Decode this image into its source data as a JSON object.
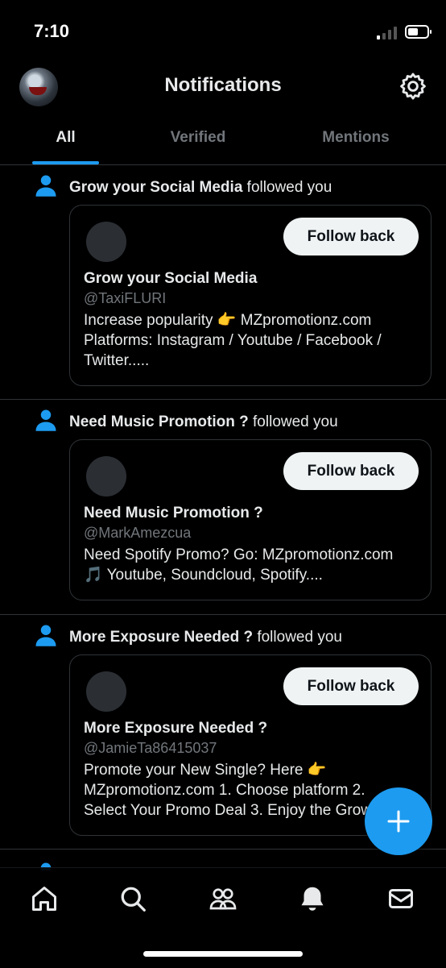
{
  "status": {
    "time": "7:10"
  },
  "header": {
    "title": "Notifications",
    "settings_icon": "gear-icon"
  },
  "tabs": [
    {
      "label": "All",
      "active": true
    },
    {
      "label": "Verified",
      "active": false
    },
    {
      "label": "Mentions",
      "active": false
    }
  ],
  "notifications": [
    {
      "actor": "Grow your Social Media",
      "action": " followed you",
      "card": {
        "follow_label": "Follow back",
        "name": "Grow your Social Media",
        "handle": "@TaxiFLURI",
        "bio": [
          "Increase popularity 👉 MZpromotionz.com",
          "Platforms: Instagram / Youtube / Facebook /",
          "Twitter....."
        ]
      }
    },
    {
      "actor": "Need Music Promotion ?",
      "action": " followed you",
      "card": {
        "follow_label": "Follow back",
        "name": "Need Music Promotion ?",
        "handle": "@MarkAmezcua",
        "bio": [
          "Need Spotify Promo? Go: MZpromotionz.com",
          "🎵 Youtube, Soundcloud, Spotify...."
        ]
      }
    },
    {
      "actor": "More Exposure Needed ?",
      "action": " followed you",
      "card": {
        "follow_label": "Follow back",
        "name": "More Exposure Needed ?",
        "handle": "@JamieTa86415037",
        "bio": [
          "Promote your New Single? Here 👉",
          "MZpromotionz.com 1. Choose platform 2.",
          "Select Your Promo Deal 3. Enjoy the Grow"
        ]
      }
    }
  ],
  "fab": {
    "icon": "plus-icon"
  },
  "bottom_nav": [
    "home-icon",
    "search-icon",
    "communities-icon",
    "notifications-bell-icon",
    "messages-icon"
  ],
  "colors": {
    "accent": "#1d9bf0",
    "background": "#000000",
    "muted": "#71767b"
  }
}
